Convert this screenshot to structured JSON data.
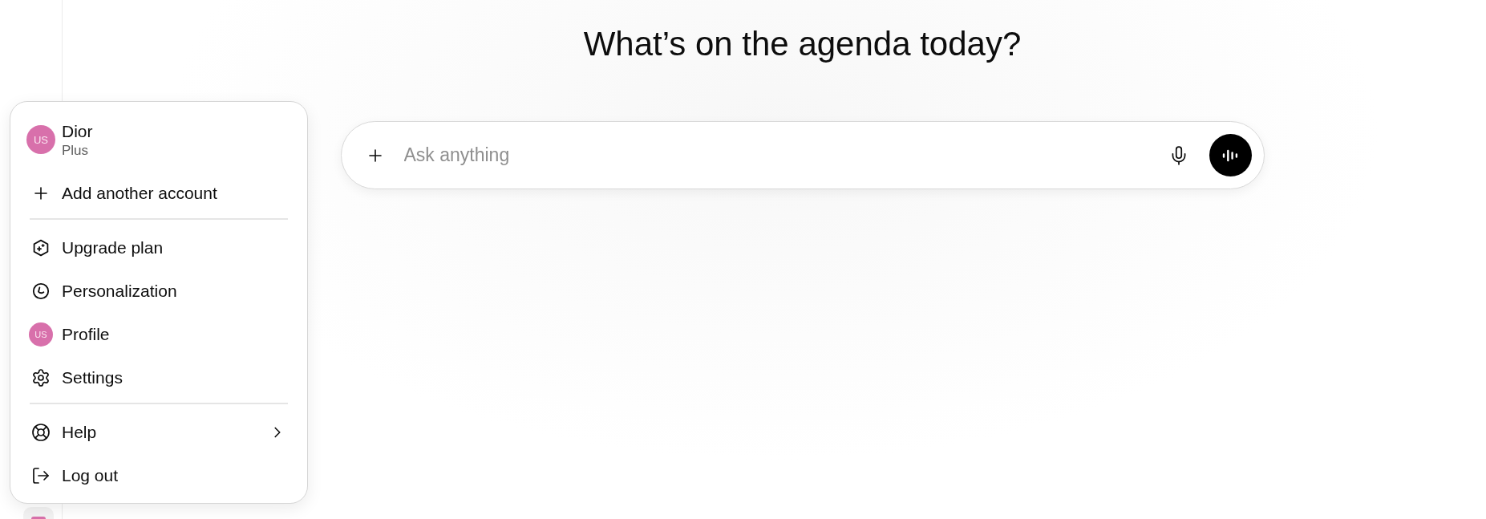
{
  "heading": "What’s on the agenda today?",
  "composer": {
    "placeholder": "Ask anything"
  },
  "account_menu": {
    "account": {
      "avatar": "US",
      "name": "Dior",
      "plan": "Plus"
    },
    "sections": [
      [
        {
          "kind": "add",
          "label": "Add another account",
          "submenu": false
        }
      ],
      [
        {
          "kind": "upgrade",
          "label": "Upgrade plan",
          "submenu": false
        },
        {
          "kind": "personalization",
          "label": "Personalization",
          "submenu": false
        },
        {
          "kind": "profile",
          "label": "Profile",
          "avatar": "US",
          "submenu": false
        },
        {
          "kind": "settings",
          "label": "Settings",
          "submenu": false
        }
      ],
      [
        {
          "kind": "help",
          "label": "Help",
          "submenu": true
        },
        {
          "kind": "logout",
          "label": "Log out",
          "submenu": false
        }
      ]
    ]
  }
}
